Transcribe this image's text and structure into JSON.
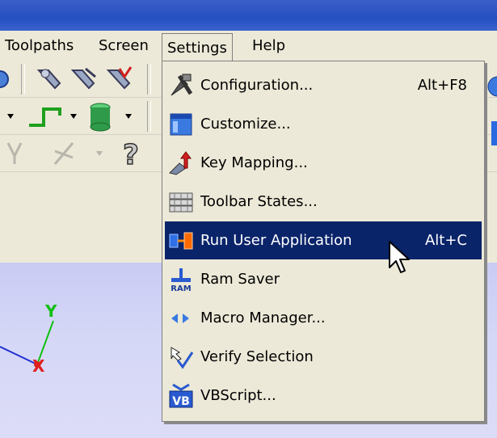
{
  "menubar": {
    "items": [
      {
        "label": "Toolpaths"
      },
      {
        "label": "Screen"
      },
      {
        "label": "Settings"
      },
      {
        "label": "Help"
      }
    ]
  },
  "settings_menu": {
    "items": [
      {
        "label": "Configuration...",
        "shortcut": "Alt+F8",
        "icon": "configuration-icon"
      },
      {
        "label": "Customize...",
        "shortcut": "",
        "icon": "customize-icon"
      },
      {
        "label": "Key Mapping...",
        "shortcut": "",
        "icon": "key-mapping-icon"
      },
      {
        "label": "Toolbar States...",
        "shortcut": "",
        "icon": "toolbar-states-icon"
      },
      {
        "label": "Run User Application",
        "shortcut": "Alt+C",
        "icon": "run-user-application-icon",
        "highlighted": true
      },
      {
        "label": "Ram Saver",
        "shortcut": "",
        "icon": "ram-saver-icon"
      },
      {
        "label": "Macro Manager...",
        "shortcut": "",
        "icon": "macro-manager-icon"
      },
      {
        "label": "Verify Selection",
        "shortcut": "",
        "icon": "verify-selection-icon"
      },
      {
        "label": "VBScript...",
        "shortcut": "",
        "icon": "vbscript-icon"
      }
    ]
  },
  "icon_text": {
    "ram": "RAM",
    "vb": "VB"
  },
  "axes": {
    "y_label": "Y",
    "x_label": "X"
  },
  "colors": {
    "title_bar": "#2450c0",
    "menu_bg": "#ece9d8",
    "highlight": "#0a246a",
    "viewport": "#d0d2f5"
  }
}
